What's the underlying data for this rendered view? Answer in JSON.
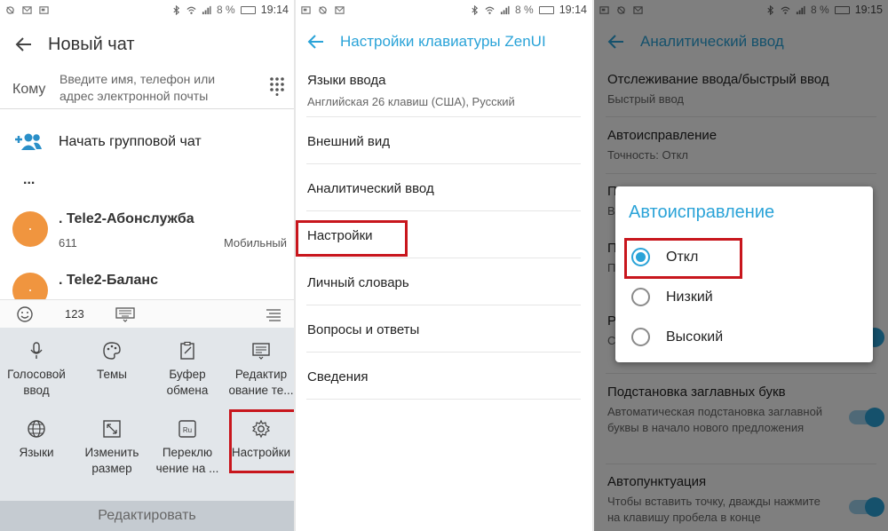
{
  "status_bars": [
    {
      "battery": "8 %",
      "time": "19:14"
    },
    {
      "battery": "8 %",
      "time": "19:14"
    },
    {
      "battery": "8 %",
      "time": "19:15"
    }
  ],
  "panel1": {
    "title": "Новый чат",
    "to_label": "Кому",
    "to_placeholder": "Введите имя, телефон или адрес электронной почты",
    "group_chat": "Начать групповой чат",
    "ellipsis": "...",
    "contacts": [
      {
        "name": ". Tele2-Абонслужба",
        "number": "611",
        "type": "Мобильный"
      },
      {
        "name": ". Tele2-Баланс",
        "number": "",
        "type": ""
      }
    ],
    "keyboard_toolbar": {
      "numbers": "123"
    },
    "keyboard_items": [
      {
        "label": "Голосовой ввод",
        "icon": "microphone-icon"
      },
      {
        "label": "Темы",
        "icon": "palette-icon"
      },
      {
        "label": "Буфер обмена",
        "icon": "clipboard-icon"
      },
      {
        "label": "Редактир ование те...",
        "icon": "edit-text-icon"
      },
      {
        "label": "Языки",
        "icon": "globe-icon"
      },
      {
        "label": "Изменить размер",
        "icon": "resize-icon"
      },
      {
        "label": "Переклю чение на ...",
        "icon": "ru-switch-icon"
      },
      {
        "label": "Настройки",
        "icon": "gear-icon"
      }
    ],
    "footer": "Редактировать"
  },
  "panel2": {
    "title": "Настройки клавиатуры ZenUI",
    "items": [
      {
        "label": "Языки ввода",
        "sub": "Английская 26 клавиш (США), Русский"
      },
      {
        "label": "Внешний вид",
        "sub": ""
      },
      {
        "label": "Аналитический ввод",
        "sub": ""
      },
      {
        "label": "Настройки",
        "sub": ""
      },
      {
        "label": "Личный словарь",
        "sub": ""
      },
      {
        "label": "Вопросы и ответы",
        "sub": ""
      },
      {
        "label": "Сведения",
        "sub": ""
      }
    ]
  },
  "panel3": {
    "title": "Аналитический ввод",
    "items": [
      {
        "label": "Отслеживание ввода/быстрый ввод",
        "sub": "Быстрый ввод"
      },
      {
        "label": "Автоисправление",
        "sub": "Точность: Откл"
      },
      {
        "label": "П",
        "sub": "В"
      },
      {
        "label": "П",
        "sub": "П п"
      },
      {
        "label": "Р",
        "sub": "С в"
      },
      {
        "label": "Подстановка заглавных букв",
        "sub": "Автоматическая подстановка заглавной буквы в начало нового предложения"
      },
      {
        "label": "Автопунктуация",
        "sub": "Чтобы вставить точку, дважды нажмите на клавишу пробела в конце"
      }
    ],
    "dialog": {
      "title": "Автоисправление",
      "options": [
        "Откл",
        "Низкий",
        "Высокий"
      ],
      "selected": "Откл"
    }
  },
  "colors": {
    "accent": "#2aa3d8",
    "highlight": "#c8161d",
    "avatar": "#f0953f"
  }
}
